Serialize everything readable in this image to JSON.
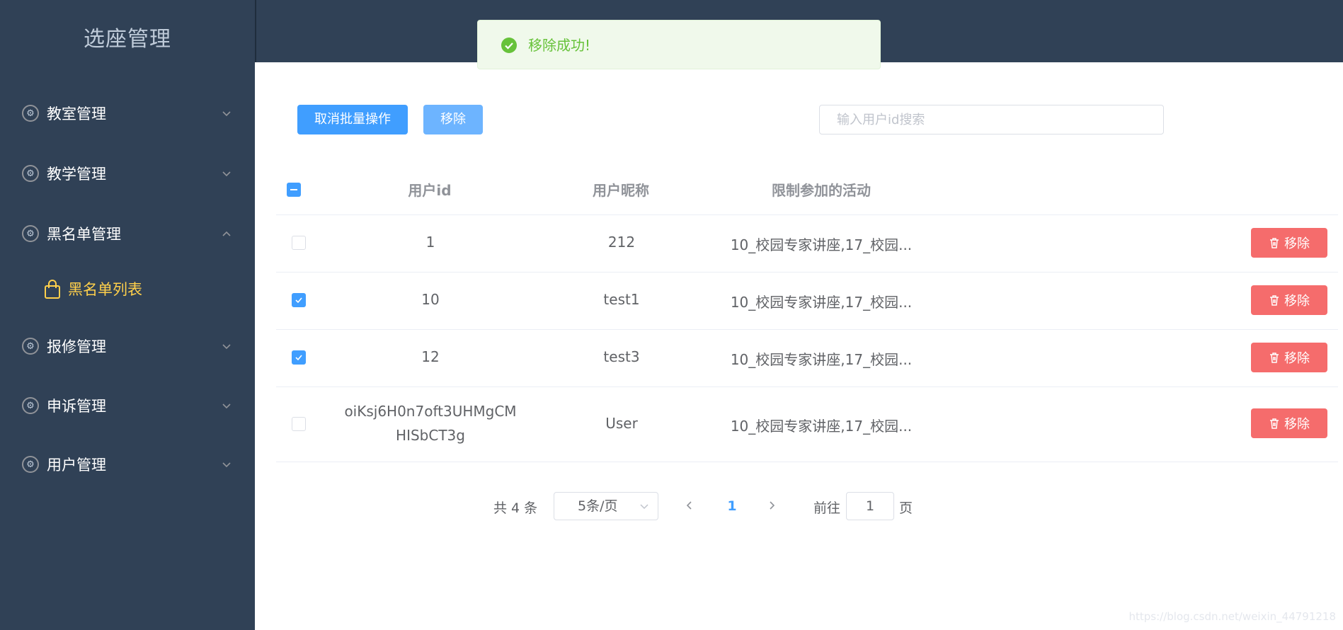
{
  "sidebar": {
    "title": "选座管理",
    "items": [
      {
        "label": "教室管理",
        "icon": "gear-icon",
        "expanded": false
      },
      {
        "label": "教学管理",
        "icon": "gear-icon",
        "expanded": false
      },
      {
        "label": "黑名单管理",
        "icon": "gear-icon",
        "expanded": true
      },
      {
        "label": "报修管理",
        "icon": "gear-icon",
        "expanded": false
      },
      {
        "label": "申诉管理",
        "icon": "gear-icon",
        "expanded": false
      },
      {
        "label": "用户管理",
        "icon": "gear-icon",
        "expanded": false
      }
    ],
    "active_subitem": {
      "label": "黑名单列表",
      "icon": "bag-icon"
    }
  },
  "toast": {
    "text": "移除成功!",
    "type": "success"
  },
  "toolbar": {
    "cancel_batch_label": "取消批量操作",
    "remove_label": "移除",
    "search_placeholder": "输入用户id搜索"
  },
  "table": {
    "columns": [
      "用户id",
      "用户昵称",
      "限制参加的活动"
    ],
    "rows": [
      {
        "id": "1",
        "nickname": "212",
        "activities": "10_校园专家讲座,17_校园...",
        "checked": false,
        "action": "移除"
      },
      {
        "id": "10",
        "nickname": "test1",
        "activities": "10_校园专家讲座,17_校园...",
        "checked": true,
        "action": "移除"
      },
      {
        "id": "12",
        "nickname": "test3",
        "activities": "10_校园专家讲座,17_校园...",
        "checked": true,
        "action": "移除"
      },
      {
        "id_line1": "oiKsj6H0n7oft3UHMgCM",
        "id_line2": "HISbCT3g",
        "nickname": "User",
        "activities": "10_校园专家讲座,17_校园...",
        "checked": false,
        "action": "移除"
      }
    ]
  },
  "pagination": {
    "total_text": "共 4 条",
    "page_size": "5条/页",
    "current_page": "1",
    "goto_label": "前往",
    "goto_value": "1",
    "page_unit": "页"
  },
  "watermark": "https://blog.csdn.net/weixin_44791218",
  "colors": {
    "sidebar_bg": "#304156",
    "primary": "#409eff",
    "danger": "#f56c6c",
    "success": "#67c23a",
    "active_menu": "#ffd04b"
  }
}
